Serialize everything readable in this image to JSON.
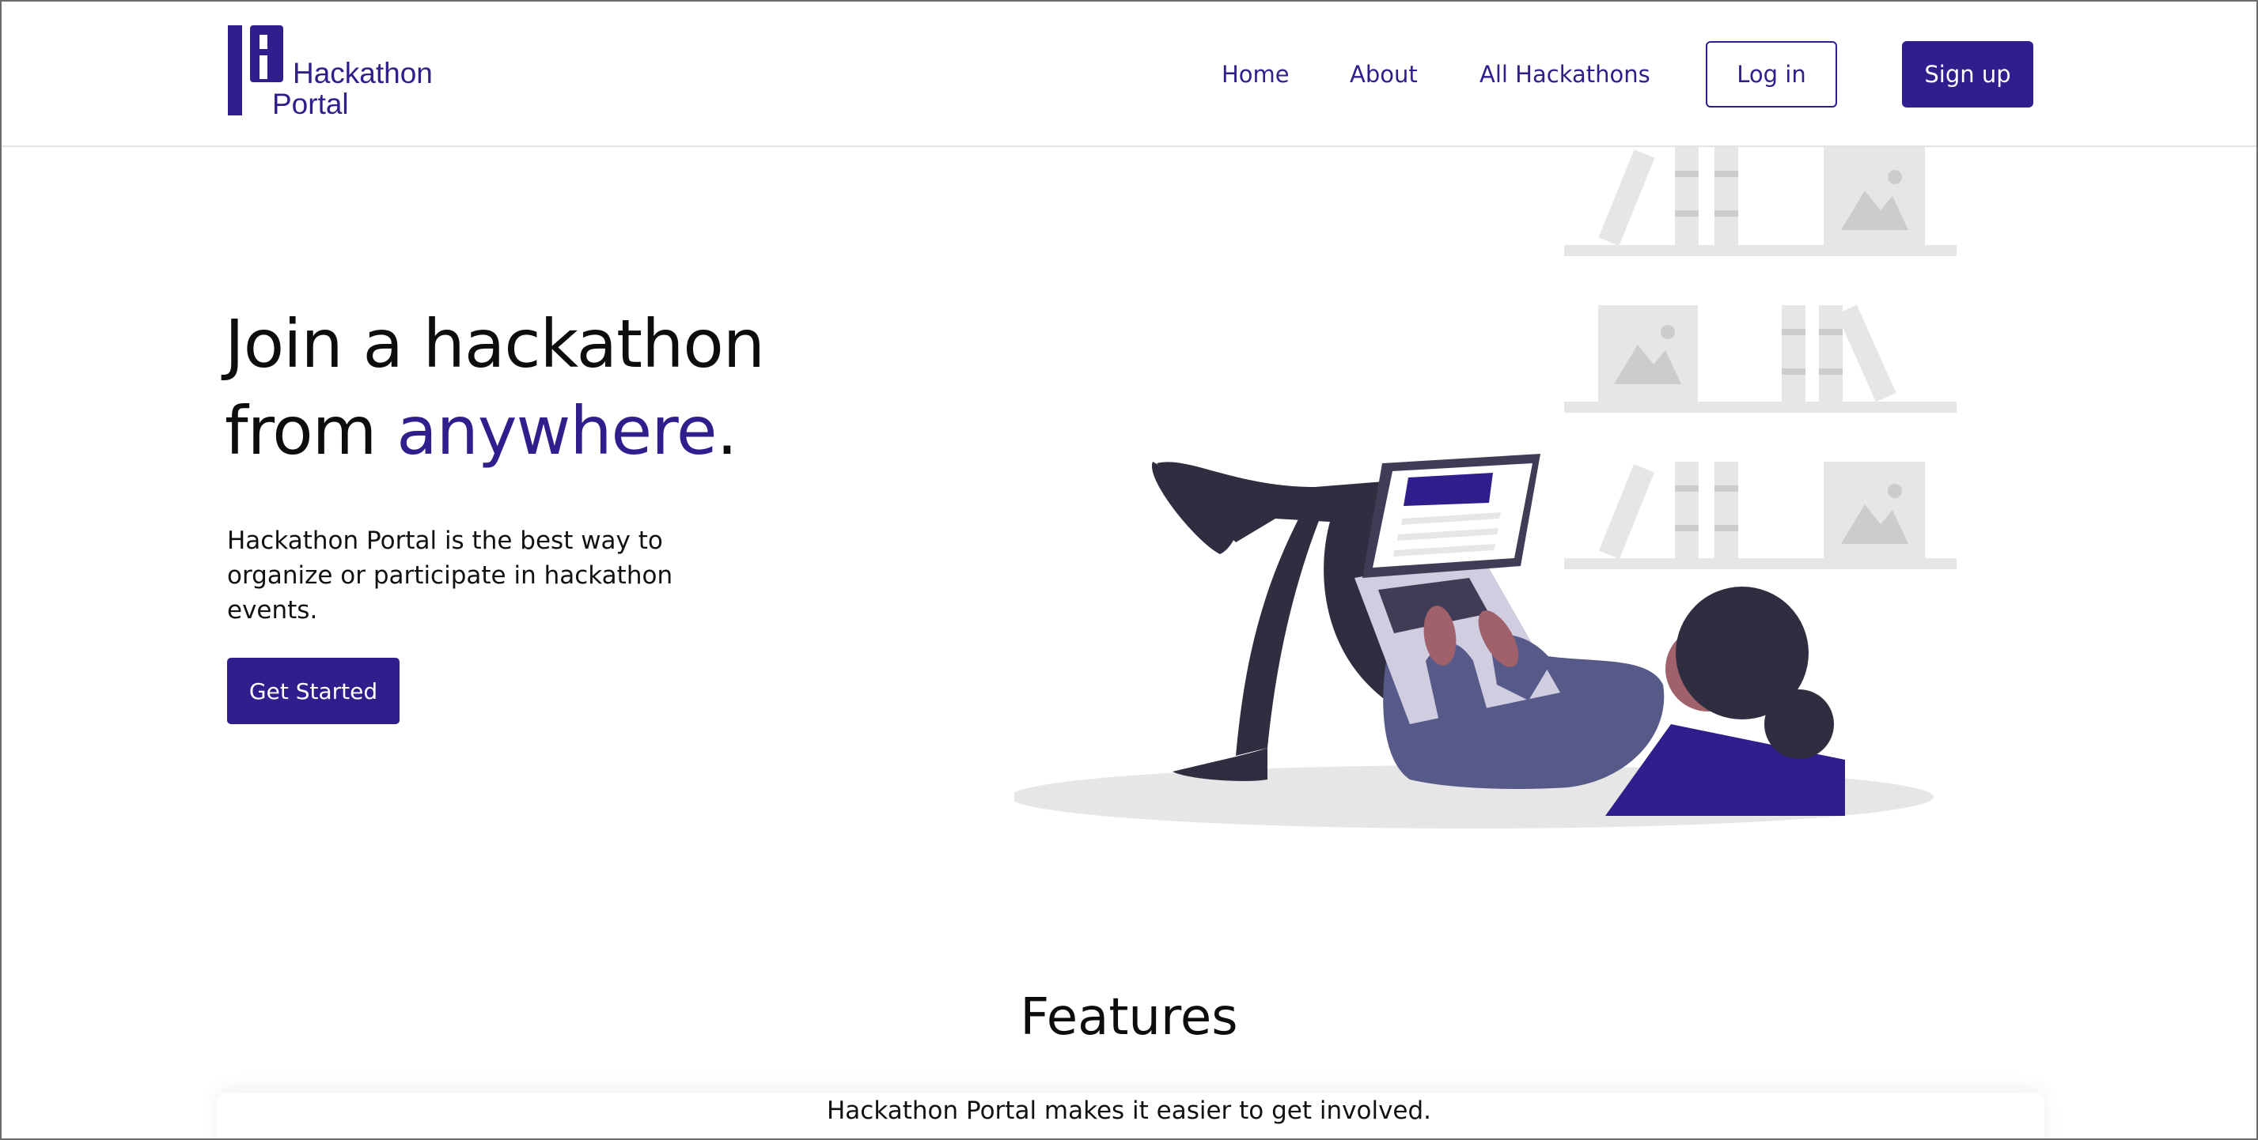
{
  "header": {
    "logo_line1": "Hackathon",
    "logo_line2": "Portal",
    "nav": {
      "home": "Home",
      "about": "About",
      "all_hackathons": "All Hackathons"
    },
    "login_label": "Log in",
    "signup_label": "Sign up"
  },
  "hero": {
    "title_line1": "Join a hackathon",
    "title_line2_prefix": "from ",
    "title_line2_accent": "anywhere",
    "title_line2_suffix": ".",
    "subtitle": "Hackathon Portal is the best way to organize or participate in hackathon events.",
    "cta_label": "Get Started"
  },
  "features": {
    "title": "Features",
    "subtitle": "Hackathon Portal makes it easier to get involved."
  },
  "colors": {
    "brand": "#2e1f8c",
    "text": "#111111",
    "muted_illustration": "#e6e6e6"
  },
  "icons": {
    "logo": "hackathon-portal-logo-icon",
    "illustration": "person-laptop-illustration"
  }
}
